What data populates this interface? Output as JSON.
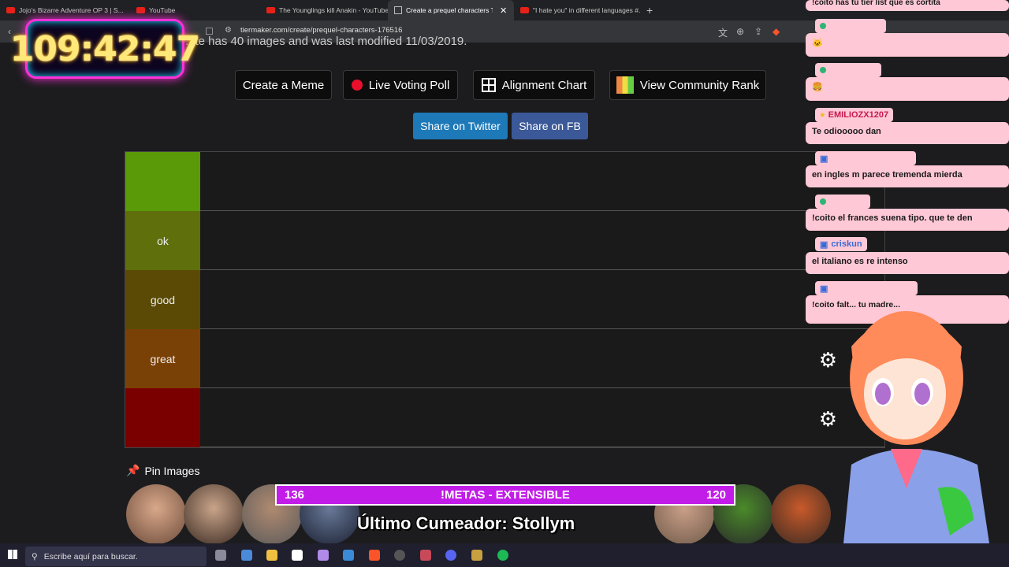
{
  "tabs": [
    {
      "label": "Jojo's Bizarre Adventure OP 3 | S..."
    },
    {
      "label": "YouTube"
    },
    {
      "label": "The Younglings kill Anakin - YouTube"
    },
    {
      "label": "Create a prequel characters Tier"
    },
    {
      "label": "\"I hate you\" in different languages #..."
    }
  ],
  "browser": {
    "url": "tiermaker.com/create/prequel-characters-176516",
    "new_tab": "+"
  },
  "page": {
    "subtitle": "...te has 40 images and was last modified 11/03/2019.",
    "buttons": {
      "meme": "Create a Meme",
      "poll": "Live Voting Poll",
      "alignment": "Alignment Chart",
      "community": "View Community Rank"
    },
    "share": {
      "twitter": "Share on Twitter",
      "fb": "Share on FB"
    },
    "tiers": [
      {
        "label": "",
        "color": "#5a9a08"
      },
      {
        "label": "ok",
        "color": "#5e6f0c"
      },
      {
        "label": "good",
        "color": "#5a4a06"
      },
      {
        "label": "great",
        "color": "#7a4106"
      },
      {
        "label": "",
        "color": "#7a0000"
      }
    ],
    "pin_images": "Pin Images"
  },
  "overlay": {
    "timer": "109:42:47",
    "metas_left": "136",
    "metas_center": "!METAS - EXTENSIBLE",
    "metas_right": "120",
    "cumeador": "Último Cumeador: Stollym"
  },
  "chat": [
    {
      "name": "",
      "text": "!coito has tu tier list que es cortita"
    },
    {
      "name": "",
      "text": ""
    },
    {
      "name": "",
      "text": ""
    },
    {
      "name": "EMILIOZX1207",
      "text": "Te odiooooo dan"
    },
    {
      "name": "",
      "text": "en ingles m parece tremenda mierda"
    },
    {
      "name": "",
      "text": "!coito el frances suena tipo. que te den"
    },
    {
      "name": "criskun",
      "text": "el italiano es re intenso"
    },
    {
      "name": "",
      "text": "!coito falt... tu madre..."
    }
  ],
  "taskbar": {
    "search_placeholder": "Escribe aquí para buscar."
  },
  "colors": {
    "twitter": "#1d79b8",
    "fb": "#3b5998",
    "metas": "#c21ce8",
    "chat_bubble": "#ffc8d6"
  }
}
